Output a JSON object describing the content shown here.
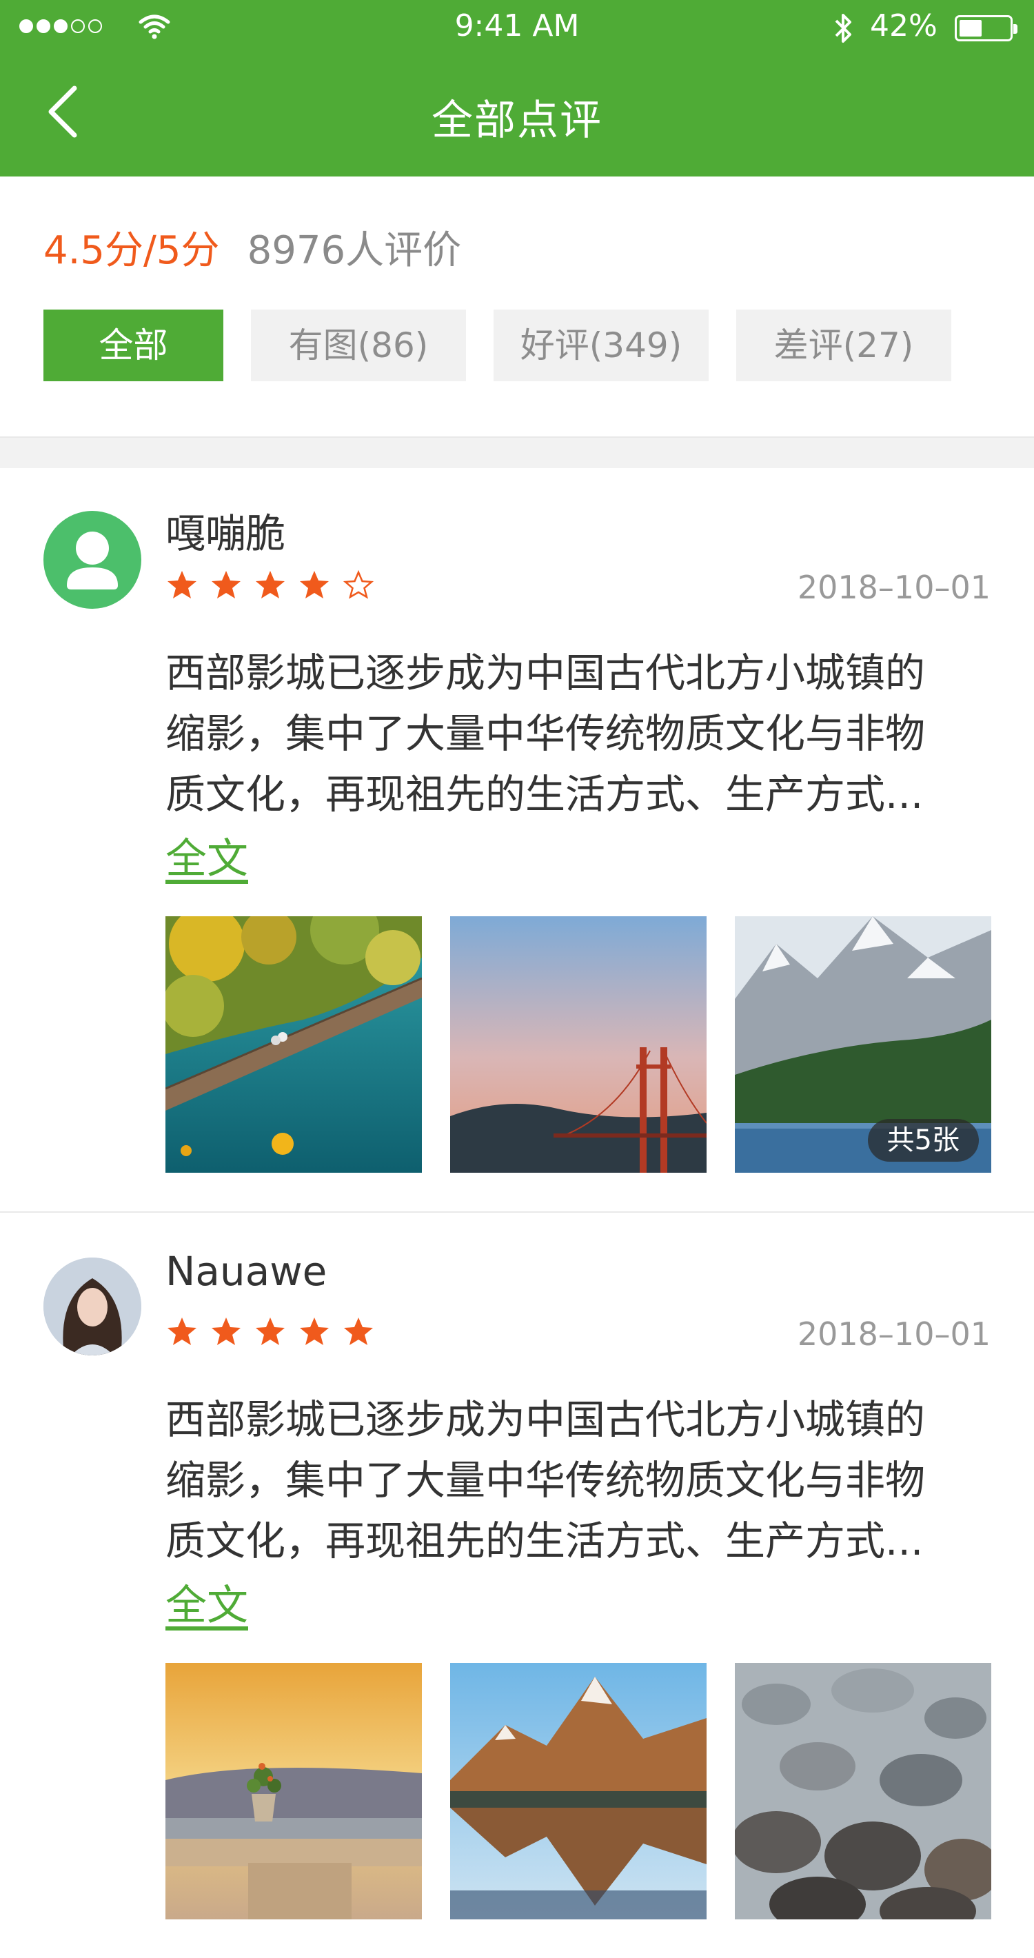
{
  "status": {
    "time": "9:41 AM",
    "battery": "42%",
    "signal_bars": 3,
    "signal_total": 5
  },
  "nav": {
    "title": "全部点评",
    "back_icon": "chevron-left-icon"
  },
  "summary": {
    "score": "4.5分/5分",
    "reviewer_count": "8976人评价"
  },
  "filters": [
    {
      "label": "全部",
      "active": true
    },
    {
      "label": "有图(86)",
      "active": false
    },
    {
      "label": "好评(349)",
      "active": false
    },
    {
      "label": "差评(27)",
      "active": false
    }
  ],
  "colors": {
    "brand": "#4fab36",
    "score": "#f05a1c",
    "star": "#f05a1c",
    "muted": "#999999"
  },
  "reviews": [
    {
      "username": "嘎嘣脆",
      "avatar": "default-user-icon",
      "rating": 4,
      "rating_max": 5,
      "date": "2018–10–01",
      "text_lines": [
        "西部影城已逐步成为中国古代北方小城镇的",
        "缩影，集中了大量中华传统物质文化与非物",
        "质文化，再现祖先的生活方式、生产方式..."
      ],
      "full_link": "全文",
      "photos": [
        "lake-boardwalk-photo",
        "golden-gate-bridge-photo",
        "mountain-lake-photo"
      ],
      "photo_count_badge": "共5张"
    },
    {
      "username": "Nauawe",
      "avatar": "user-photo-avatar",
      "rating": 5,
      "rating_max": 5,
      "date": "2018–10–01",
      "text_lines": [
        "西部影城已逐步成为中国古代北方小城镇的",
        "缩影，集中了大量中华传统物质文化与非物",
        "质文化，再现祖先的生活方式、生产方式..."
      ],
      "full_link": "全文",
      "photos": [
        "sunset-plant-table-photo",
        "mountain-reflection-photo",
        "river-stones-photo"
      ]
    }
  ]
}
